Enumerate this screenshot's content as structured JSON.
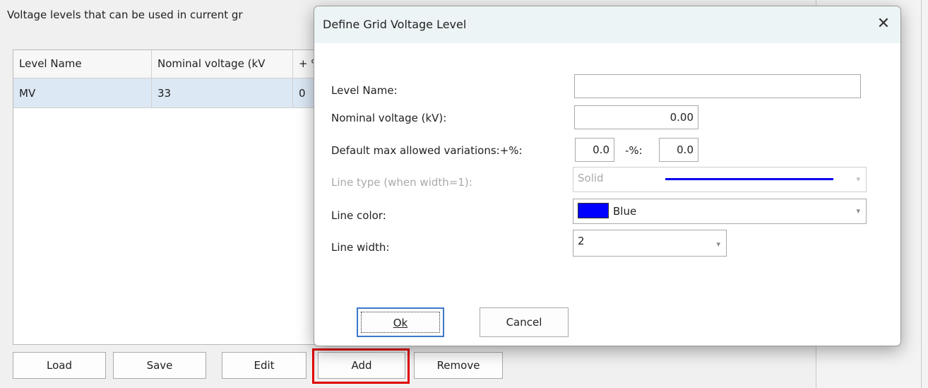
{
  "background": {
    "header_text": "Voltage levels that can be used in current gr",
    "grid": {
      "columns": [
        "Level Name",
        "Nominal voltage (kV",
        "+ %"
      ],
      "rows": [
        [
          "MV",
          "33",
          "0"
        ]
      ]
    },
    "buttons": {
      "load": "Load",
      "save": "Save",
      "edit": "Edit",
      "add": "Add",
      "remove": "Remove"
    }
  },
  "dialog": {
    "title": "Define Grid Voltage Level",
    "close_glyph": "✕",
    "fields": {
      "level_name_label": "Level Name:",
      "level_name_value": "",
      "nominal_voltage_label": "Nominal voltage (kV):",
      "nominal_voltage_value": "0.00",
      "variations_label": "Default max allowed variations:+%:",
      "plus_value": "0.0",
      "minus_label": "-%:",
      "minus_value": "0.0",
      "line_type_label": "Line type (when width=1):",
      "line_type_value": "Solid",
      "line_color_label": "Line color:",
      "line_color_value": "Blue",
      "line_width_label": "Line width:",
      "line_width_value": "2"
    },
    "buttons": {
      "ok": "Ok",
      "cancel": "Cancel"
    }
  },
  "colors": {
    "highlight": "#e00000",
    "line_color": "#0000ff",
    "selected_row": "#dce8f4"
  }
}
